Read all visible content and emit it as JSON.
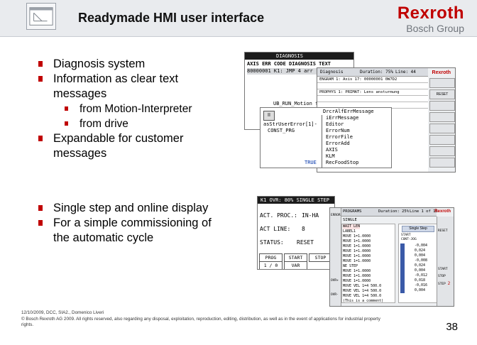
{
  "header": {
    "title": "Readymade HMI user interface",
    "brand_name": "Rexroth",
    "brand_sub": "Bosch Group"
  },
  "bullets_top": [
    {
      "text": "Diagnosis system",
      "level": 1
    },
    {
      "text": "Information as clear text",
      "level": 1
    },
    {
      "text": "messages",
      "level": 1,
      "continuation": true
    },
    {
      "text": "from Motion-Interpreter",
      "level": 2
    },
    {
      "text": "from drive",
      "level": 2
    },
    {
      "text": "Expandable for customer",
      "level": 1
    },
    {
      "text": "messages",
      "level": 1,
      "continuation": true
    }
  ],
  "bullets_bottom": [
    {
      "text": "Single step and online display",
      "level": 1
    },
    {
      "text": "For a simple commissioning of",
      "level": 1
    },
    {
      "text": "the automatic cycle",
      "level": 1,
      "continuation": true
    }
  ],
  "diag_shot": {
    "back_title": "DIAGNOSIS",
    "back_header": "AXIS ERR CODE DIAGNOSIS TEXT",
    "back_row": "80000001 K1: JMP 4 arr",
    "back_row2": "UB_RUN_Motion f",
    "mid_title": "Diagnosis",
    "mid_duration": "Duration: 75%",
    "mid_line": "Line: 44",
    "mid_rows": [
      "ENGRAM 1: Axis 17: 00000001 0W7D2",
      "PROPHYS 1: PRIMAT: Lens ansturmung"
    ],
    "side_buttons": [
      "",
      "RESET",
      "",
      "",
      "",
      "",
      "",
      "",
      "",
      "",
      ""
    ],
    "var_title": "DrcrAlfErrMessage",
    "var_names": [
      "iErrMessage",
      "Editor",
      "ErrorNum",
      "ErrorFile",
      "ErrorAdd",
      "AXIS",
      "KLM",
      "RecFoodStop"
    ],
    "var_left": [
      "asStrUserError[1]-",
      "CONST_PRG",
      "",
      "",
      "",
      "",
      "",
      "TRUE"
    ],
    "red_logo": "Rexroth"
  },
  "step_shot": {
    "back_title": "K1    OVR: 80% SINGLE  STEP",
    "rows": [
      {
        "label": "ACT. PROC.:",
        "value": "IN-HA"
      },
      {
        "label": "ACT LINE:",
        "value": "8"
      },
      {
        "label": "STATUS:",
        "value": "RESET"
      }
    ],
    "cells": [
      "PROG",
      "START",
      "STOP",
      "1 / 0",
      "VAR",
      ""
    ],
    "front_title": "PROGRAMS",
    "front_duration": "Duration: 25%",
    "front_line": "Line 1 of 15",
    "front_single": "SINGLE",
    "code_lines": [
      "WAIT LEN",
      "LABEL1",
      "MOVE 1=1.0000",
      "MOVE 1=1.0000",
      "MOVE 1=1.0000",
      "MOVE 1=1.0000",
      "MOVE 1=1.0000",
      "MOVE 1=1.0000",
      "NE STEP",
      "MOVE 1=1.0000",
      "MOVE 1=1.0000",
      "MOVE 1=1.0000",
      "MOVE VEL 1=4 500.0",
      "MOVE VEL 1=4 500.0",
      "MOVE VEL 1=4 500.0",
      "(This is a comment)"
    ],
    "single_step_label": "Single Step",
    "sub_labels": [
      "START",
      "CONT-JOG"
    ],
    "values": [
      "-0,004",
      "0,024",
      "0,004",
      "-0,008",
      "0,024",
      "0,004",
      "-0,012",
      "0,018",
      "-0,016",
      "0,004"
    ],
    "left_btns": [
      "ERROR",
      "",
      "",
      "",
      "",
      "",
      "",
      "OVR+",
      "OVR-"
    ],
    "right_btns": [
      "",
      "RESET",
      "",
      "",
      "",
      "",
      "START",
      "STOP",
      "STEP"
    ],
    "red_logo": "Rexroth",
    "step_num": "2"
  },
  "footer": {
    "line1": "12/10/2009, DCC, SIA2., Domenico Liveri",
    "line2": "© Bosch Rexroth AG 2009. All rights reserved, also regarding any disposal, exploitation, reproduction, editing, distribution, as well as in the event of applications for industrial property",
    "line3": "rights."
  },
  "page_number": "38"
}
